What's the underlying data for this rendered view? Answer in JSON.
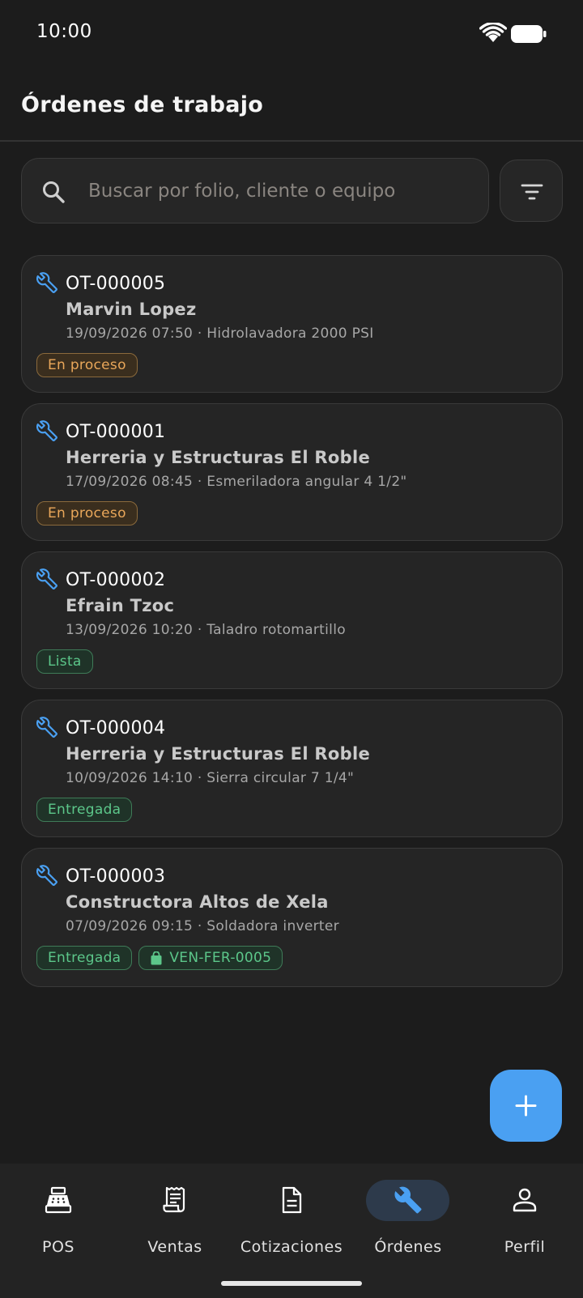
{
  "status_bar": {
    "time": "10:00"
  },
  "header": {
    "title": "Órdenes de trabajo"
  },
  "search": {
    "placeholder": "Buscar por folio, cliente o equipo"
  },
  "orders": [
    {
      "id": "OT-000005",
      "client": "Marvin Lopez",
      "meta": "19/09/2026 07:50 · Hidrolavadora 2000 PSI",
      "status": "En proceso"
    },
    {
      "id": "OT-000001",
      "client": "Herreria y Estructuras El Roble",
      "meta": "17/09/2026 08:45 · Esmeriladora angular 4 1/2\"",
      "status": "En proceso"
    },
    {
      "id": "OT-000002",
      "client": "Efrain Tzoc",
      "meta": "13/09/2026 10:20 · Taladro rotomartillo",
      "status": "Lista"
    },
    {
      "id": "OT-000004",
      "client": "Herreria y Estructuras El Roble",
      "meta": "10/09/2026 14:10 · Sierra circular 7 1/4\"",
      "status": "Entregada"
    },
    {
      "id": "OT-000003",
      "client": "Constructora Altos de Xela",
      "meta": "07/09/2026 09:15 · Soldadora inverter",
      "status": "Entregada",
      "sale_ref": "VEN-FER-0005"
    }
  ],
  "nav": {
    "items": [
      {
        "label": "POS",
        "icon": "cash-register-icon"
      },
      {
        "label": "Ventas",
        "icon": "receipt-icon"
      },
      {
        "label": "Cotizaciones",
        "icon": "document-icon"
      },
      {
        "label": "Órdenes",
        "icon": "wrench-icon",
        "active": true
      },
      {
        "label": "Perfil",
        "icon": "person-icon"
      }
    ]
  },
  "colors": {
    "background": "#1c1c1c",
    "accent": "#4aa0f2",
    "status_in_progress": "#e9a75a",
    "status_done": "#5cc78a"
  }
}
